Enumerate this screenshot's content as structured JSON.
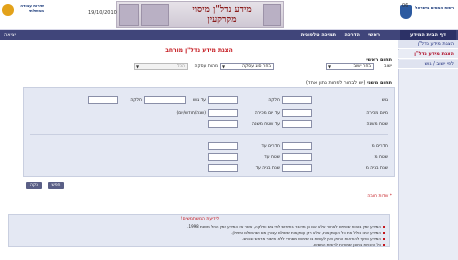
{
  "header": {
    "user_number": "06",
    "date": "19/10/2010",
    "banner_title": "מידע נדל\"ן מיסוי מקרקעין",
    "logo_right_text": "רשות המסים בישראל",
    "logo_left_text": "שירות עבודה ממשלתי"
  },
  "navbar": {
    "home": "דף הבית המידע",
    "items": [
      "ראשי",
      "הדרכה",
      "תמיכה טלפונית"
    ],
    "exit": "יציאה"
  },
  "sidebar": {
    "items": [
      {
        "label": "הצגת מידע נדל\"ן"
      },
      {
        "label": "הצגת מידע נדל\"ן מורחב"
      },
      {
        "label": "לפי ישוב / גוש"
      }
    ]
  },
  "main": {
    "title": "הצגת מידע נדל\"ן מורחב",
    "section_main": "תחום ראשי",
    "section_secondary": "תחום משני",
    "section_secondary_hint": "(יש לבחור לפחות נתון אחד)",
    "select_settlement": {
      "value": "בחר ישוב",
      "label": "ישוב"
    },
    "select_type": {
      "value": "בחר סוג עסקה",
      "label": "מהות עסקה"
    },
    "select_disabled": {
      "value": "הכל"
    },
    "fields": {
      "block": "גוש",
      "parcel": "חלקה",
      "to_block": "עד גוש",
      "parcel2": "חלקה",
      "deal_date": "מיום מכירה",
      "to_deal_date": "עד יום מכירה",
      "date_format": "(שנה/חודש/יום)",
      "area": "שטח משנה",
      "to_area": "עד שטח משנה",
      "rooms_from": "חדרים מ",
      "rooms_to": "חדרים עד",
      "size_from": "שטח מ",
      "size_to": "שטח עד",
      "year_from": "שנת בניה מ",
      "year_to": "שנת בניה עד"
    },
    "buttons": {
      "search": "חפש",
      "clear": "נקה"
    },
    "required_note": "* שדות חובה",
    "notice": {
      "title": "לידיעת המשתמשים!",
      "lines": [
        "המידע זמין בטווח שנתיים לאחור אלא אם כן מדובר בחיפוש לפי גוש וחלקה, אשר אז המידע זמין החל משנת 1998.",
        "המידע אינו כולל את כל העסקאות, אלא רק עסקאות ששולם עבורן מס ושהושלם טיפולן.",
        "המידע כפוף להוראות החוק ואין לעשות בו שימוש מסחרי ללא אישור מראש ובכתב.",
        "כל הזכויות בתוכן שמורות לרשות המסים."
      ]
    }
  },
  "colors": {
    "nav_bg": "#40457a",
    "accent_red": "#c4161c",
    "panel_bg": "#e4e8f3",
    "sidebar_bg": "#e9ecf5"
  }
}
